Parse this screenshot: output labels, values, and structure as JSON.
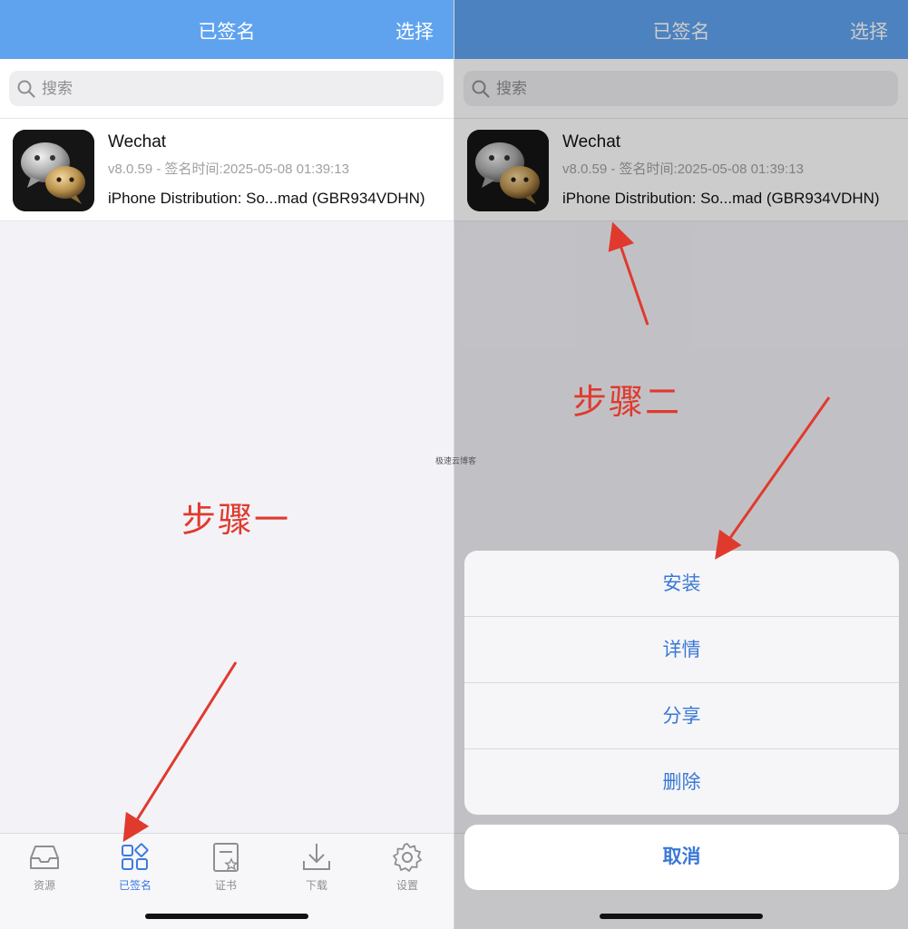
{
  "navbar": {
    "title": "已签名",
    "action": "选择"
  },
  "search": {
    "placeholder": "搜索"
  },
  "app": {
    "name": "Wechat",
    "meta": "v8.0.59 - 签名时间:2025-05-08 01:39:13",
    "certificate": "iPhone Distribution: So...mad (GBR934VDHN)"
  },
  "tabs": [
    {
      "label": "资源",
      "icon": "inbox-icon"
    },
    {
      "label": "已签名",
      "icon": "grid-icon"
    },
    {
      "label": "证书",
      "icon": "certificate-icon"
    },
    {
      "label": "下载",
      "icon": "download-icon"
    },
    {
      "label": "设置",
      "icon": "gear-icon"
    }
  ],
  "steps": {
    "step1": "步骤一",
    "step2": "步骤二"
  },
  "action_sheet": {
    "items": [
      "安装",
      "详情",
      "分享",
      "删除"
    ],
    "cancel": "取消"
  },
  "watermark": "极速云博客",
  "colors": {
    "nav_blue": "#5fa3ef",
    "accent_blue": "#3a78d6",
    "annotation_red": "#e03a2e"
  }
}
